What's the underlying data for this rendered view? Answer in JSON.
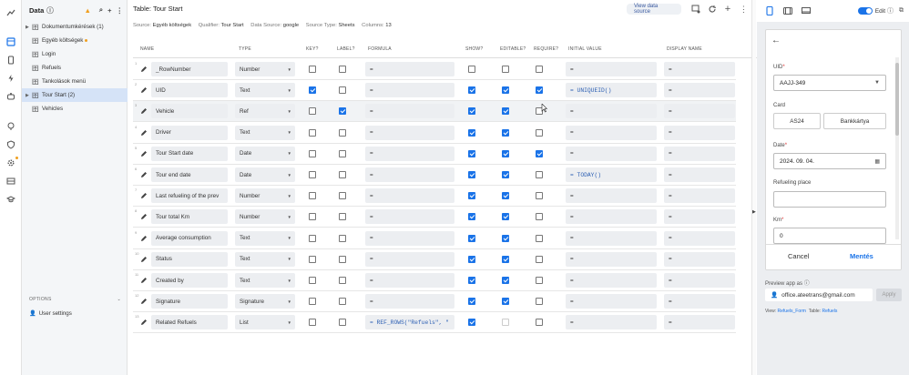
{
  "sidebar": {
    "title": "Data",
    "items": [
      {
        "label": "Dokumentumkérések (1)",
        "dot": false,
        "caret": true
      },
      {
        "label": "Egyéb költségek",
        "dot": true,
        "caret": false
      },
      {
        "label": "Login",
        "dot": false,
        "caret": false
      },
      {
        "label": "Refuels",
        "dot": false,
        "caret": false
      },
      {
        "label": "Tankolások menü",
        "dot": false,
        "caret": false
      },
      {
        "label": "Tour Start (2)",
        "dot": false,
        "caret": true,
        "selected": true
      },
      {
        "label": "Vehicles",
        "dot": false,
        "caret": false
      }
    ],
    "options_label": "OPTIONS",
    "user_settings": "User settings"
  },
  "main": {
    "title": "Table: Tour Start",
    "view_data_source": "View data source",
    "meta": {
      "source_label": "Source:",
      "source": "Egyéb költségek",
      "qualifier_label": "Qualifier:",
      "qualifier": "Tour Start",
      "datasource_label": "Data Source:",
      "datasource": "google",
      "sourcetype_label": "Source Type:",
      "sourcetype": "Sheets",
      "columns_label": "Columns:",
      "columns": "13"
    },
    "headers": {
      "name": "NAME",
      "type": "TYPE",
      "key": "KEY?",
      "label": "LABEL?",
      "formula": "FORMULA",
      "show": "SHOW?",
      "editable": "EDITABLE?",
      "require": "REQUIRE?",
      "initial": "INITIAL VALUE",
      "display": "DISPLAY NAME"
    },
    "rows": [
      {
        "num": "1",
        "name": "_RowNumber",
        "type": "Number",
        "key": false,
        "label": false,
        "formula": "=",
        "show": false,
        "editable": false,
        "require": false,
        "initial": "=",
        "display": "="
      },
      {
        "num": "2",
        "name": "UID",
        "type": "Text",
        "key": true,
        "label": false,
        "formula": "=",
        "show": true,
        "editable": true,
        "require": true,
        "initial": "= UNIQUEID()",
        "display": "="
      },
      {
        "num": "3",
        "name": "Vehicle",
        "type": "Ref",
        "key": false,
        "label": true,
        "formula": "=",
        "show": true,
        "editable": true,
        "require": false,
        "initial": "=",
        "display": "="
      },
      {
        "num": "4",
        "name": "Driver",
        "type": "Text",
        "key": false,
        "label": false,
        "formula": "=",
        "show": true,
        "editable": true,
        "require": false,
        "initial": "=",
        "display": "="
      },
      {
        "num": "5",
        "name": "Tour Start date",
        "type": "Date",
        "key": false,
        "label": false,
        "formula": "=",
        "show": true,
        "editable": true,
        "require": true,
        "initial": "=",
        "display": "="
      },
      {
        "num": "6",
        "name": "Tour end date",
        "type": "Date",
        "key": false,
        "label": false,
        "formula": "=",
        "show": true,
        "editable": true,
        "require": false,
        "initial": "= TODAY()",
        "display": "="
      },
      {
        "num": "7",
        "name": "Last refueling of the prev",
        "type": "Number",
        "key": false,
        "label": false,
        "formula": "=",
        "show": true,
        "editable": true,
        "require": false,
        "initial": "=",
        "display": "="
      },
      {
        "num": "8",
        "name": "Tour total Km",
        "type": "Number",
        "key": false,
        "label": false,
        "formula": "=",
        "show": true,
        "editable": true,
        "require": false,
        "initial": "=",
        "display": "="
      },
      {
        "num": "9",
        "name": "Average consumption",
        "type": "Text",
        "key": false,
        "label": false,
        "formula": "=",
        "show": true,
        "editable": true,
        "require": false,
        "initial": "=",
        "display": "="
      },
      {
        "num": "10",
        "name": "Status",
        "type": "Text",
        "key": false,
        "label": false,
        "formula": "=",
        "show": true,
        "editable": true,
        "require": false,
        "initial": "=",
        "display": "="
      },
      {
        "num": "11",
        "name": "Created by",
        "type": "Text",
        "key": false,
        "label": false,
        "formula": "=",
        "show": true,
        "editable": true,
        "require": false,
        "initial": "=",
        "display": "="
      },
      {
        "num": "12",
        "name": "Signature",
        "type": "Signature",
        "key": false,
        "label": false,
        "formula": "=",
        "show": true,
        "editable": true,
        "require": false,
        "initial": "=",
        "display": "="
      },
      {
        "num": "13",
        "name": "Related Refuels",
        "type": "List",
        "key": false,
        "label": false,
        "formula": "= REF_ROWS(\"Refuels\", \"",
        "show": true,
        "editable": false,
        "require": false,
        "initial": "=",
        "display": "="
      }
    ]
  },
  "preview": {
    "edit_label": "Edit",
    "fields": {
      "uid_label": "UID",
      "uid_value": "AAJJ-349",
      "card_label": "Card",
      "card_opt1": "AS24",
      "card_opt2": "Bankkártya",
      "date_label": "Date",
      "date_value": "2024. 09. 04.",
      "place_label": "Refueling place",
      "km_label": "Km",
      "km_value": "0"
    },
    "cancel": "Cancel",
    "save": "Mentés",
    "preview_as": "Preview app as",
    "email": "office.ateetrans@gmail.com",
    "apply": "Apply",
    "view_prefix": "View:",
    "view_name": "Refuels_Form",
    "table_prefix": "Table:",
    "table_name": "Refuels"
  },
  "colors": {
    "accent": "#1a73e8",
    "selected_row": "#d5e3f7",
    "warning": "#f0a020"
  }
}
